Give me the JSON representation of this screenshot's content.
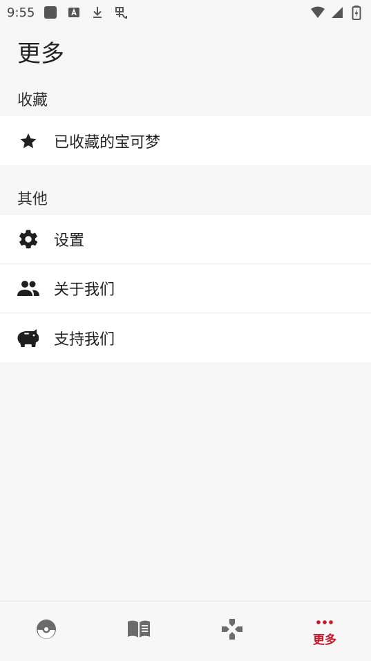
{
  "status_bar": {
    "time": "9:55",
    "icons": [
      "app-square-icon",
      "font-a-icon",
      "download-icon",
      "bug-icon",
      "wifi-icon",
      "signal-icon",
      "battery-charging-icon"
    ]
  },
  "page": {
    "title": "更多"
  },
  "sections": {
    "favorites": {
      "header": "收藏",
      "items": [
        {
          "label": "已收藏的宝可梦",
          "icon": "star-icon"
        }
      ]
    },
    "other": {
      "header": "其他",
      "items": [
        {
          "label": "设置",
          "icon": "gear-icon"
        },
        {
          "label": "关于我们",
          "icon": "people-icon"
        },
        {
          "label": "支持我们",
          "icon": "piggy-bank-icon"
        }
      ]
    }
  },
  "bottom_nav": {
    "tabs": [
      {
        "icon": "pokeball-icon",
        "label": ""
      },
      {
        "icon": "book-icon",
        "label": ""
      },
      {
        "icon": "gamepad-icon",
        "label": ""
      },
      {
        "icon": "more-dots-icon",
        "label": "更多",
        "active": true
      }
    ]
  },
  "colors": {
    "accent": "#c4152a",
    "background": "#f6f6f6",
    "card": "#ffffff",
    "icon_inactive": "#6b6b6b"
  }
}
